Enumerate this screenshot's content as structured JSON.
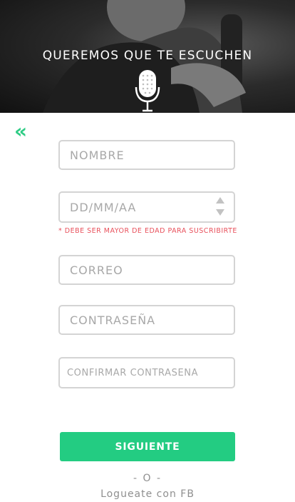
{
  "header": {
    "title": "QUEREMOS QUE TE ESCUCHEN",
    "image": "singer-with-microphone-photo",
    "icon": "microphone-icon"
  },
  "nav": {
    "back_label": "«",
    "back_icon": "double-chevron-left-icon"
  },
  "form": {
    "name_placeholder": "NOMBRE",
    "birthdate_placeholder": "DD/MM/AA",
    "age_note": "* DEBE SER MAYOR DE EDAD PARA SUSCRIBIRTE",
    "email_placeholder": "CORREO",
    "password_placeholder": "CONTRASEÑA",
    "confirm_password_placeholder": "CONFIRMAR CONTRASEÑA",
    "next_label": "SIGUIENTE"
  },
  "footer": {
    "separator": "- O -",
    "facebook_login": "Logueate con FB"
  },
  "colors": {
    "accent": "#23cc82",
    "back_arrow": "#2ecc85",
    "warning": "#e8505b",
    "border": "#d4d4d4",
    "placeholder": "#a8a8a8"
  }
}
